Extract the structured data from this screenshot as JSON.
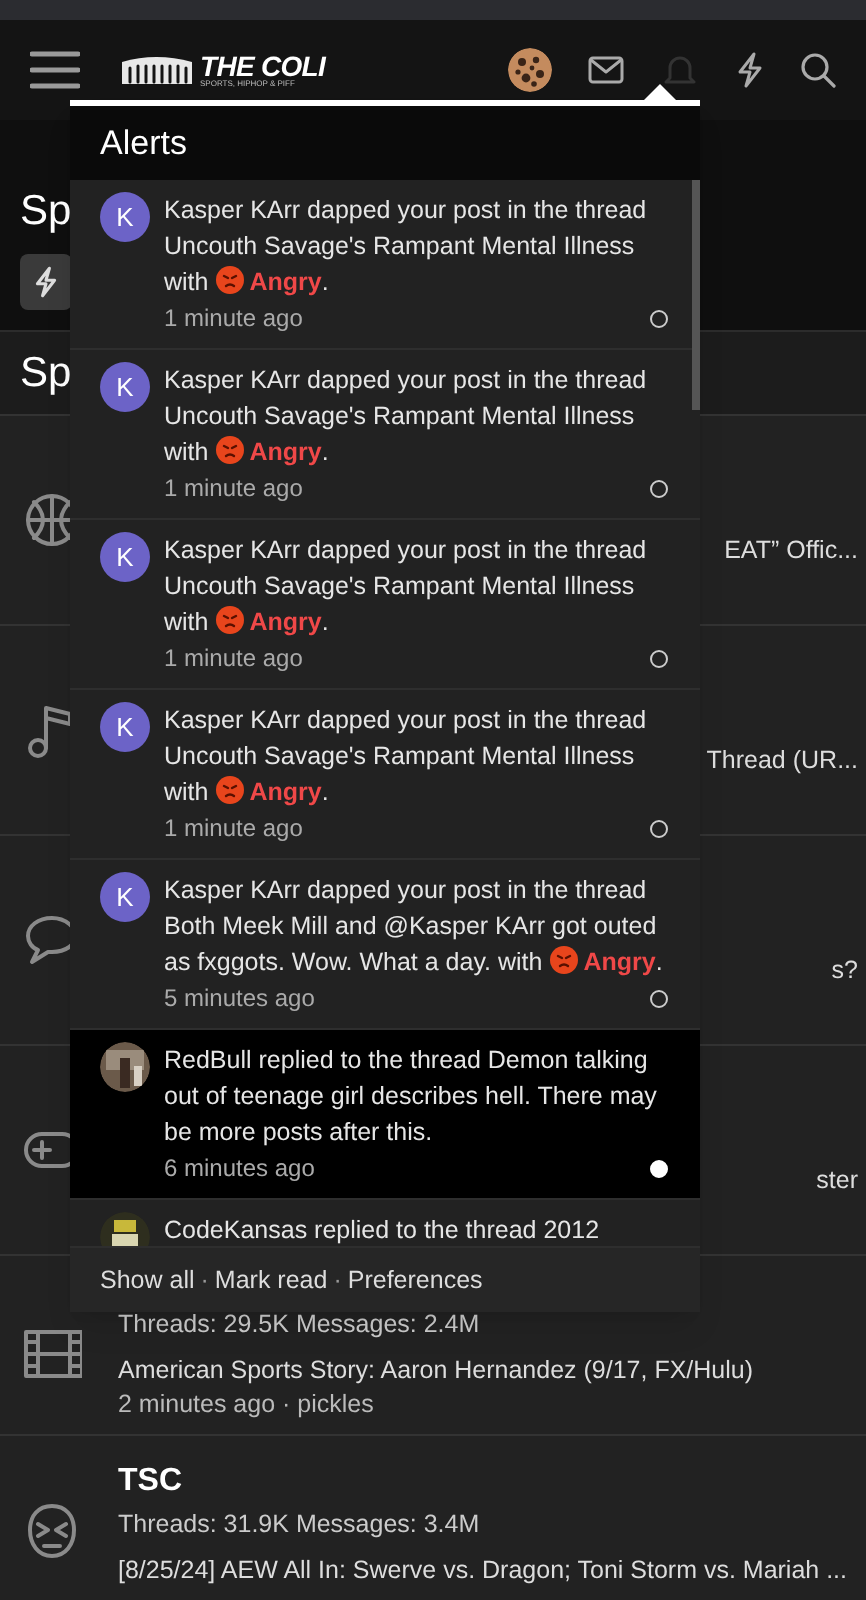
{
  "header": {
    "logo": {
      "title": "THE COLI",
      "tagline": "SPORTS, HIPHOP & PIFF"
    }
  },
  "page": {
    "title": "Sp",
    "section_title": "Sp",
    "forums": [
      {
        "fragment": "EAT” Offic..."
      },
      {
        "fragment": "Thread (UR..."
      },
      {
        "fragment": "s?"
      },
      {
        "fragment": "ster"
      },
      {
        "stats": "Threads: 29.5K Messages: 2.4M",
        "latest": "American Sports Story: Aaron Hernandez (9/17, FX/Hulu)",
        "meta": "2 minutes ago · pickles"
      },
      {
        "title": "TSC",
        "stats": "Threads: 31.9K Messages: 3.4M",
        "latest": "[8/25/24] AEW All In: Swerve vs. Dragon; Toni Storm vs. Mariah ..."
      }
    ]
  },
  "alerts": {
    "title": "Alerts",
    "items": [
      {
        "avatar": "K",
        "text": "Kasper KArr dapped your post in the thread Uncouth Savage's Rampant Mental Illness with",
        "reaction": "Angry",
        "end": ".",
        "time": "1 minute ago",
        "read": true
      },
      {
        "avatar": "K",
        "text": "Kasper KArr dapped your post in the thread Uncouth Savage's Rampant Mental Illness with",
        "reaction": "Angry",
        "end": ".",
        "time": "1 minute ago",
        "read": true
      },
      {
        "avatar": "K",
        "text": "Kasper KArr dapped your post in the thread Uncouth Savage's Rampant Mental Illness with",
        "reaction": "Angry",
        "end": ".",
        "time": "1 minute ago",
        "read": true
      },
      {
        "avatar": "K",
        "text": "Kasper KArr dapped your post in the thread Uncouth Savage's Rampant Mental Illness with",
        "reaction": "Angry",
        "end": ".",
        "time": "1 minute ago",
        "read": true
      },
      {
        "avatar": "K",
        "text": "Kasper KArr dapped your post in the thread Both Meek Mill and @Kasper KArr got outed as fxggots. Wow. What a day. with",
        "reaction": "Angry",
        "end": ".",
        "time": "5 minutes ago",
        "read": true
      },
      {
        "text": "RedBull replied to the thread Demon talking out of teenage girl describes hell. There may be more posts after this.",
        "time": "6 minutes ago",
        "read": false
      },
      {
        "text": "CodeKansas replied to the thread 2012"
      }
    ],
    "footer": [
      "Show all",
      "Mark read",
      "Preferences"
    ],
    "footer_separator": "·"
  }
}
